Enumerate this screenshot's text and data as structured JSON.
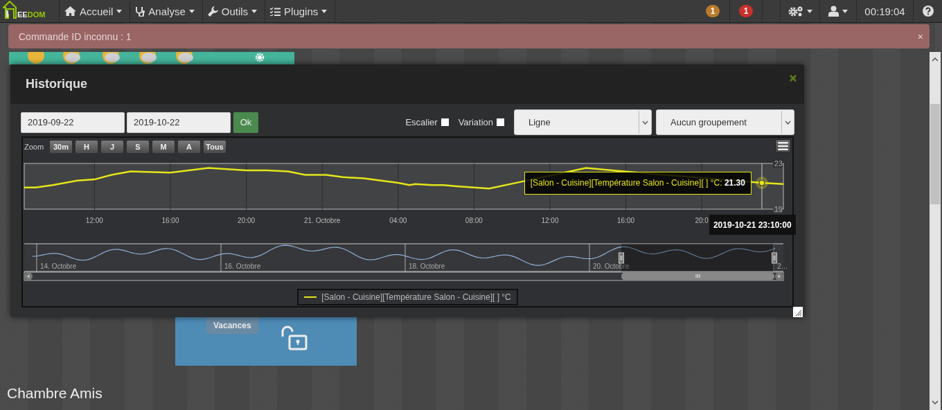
{
  "navbar": {
    "logo": {
      "parts": [
        "EE",
        "DOM"
      ]
    },
    "menus": [
      {
        "label": "Accueil"
      },
      {
        "label": "Analyse"
      },
      {
        "label": "Outils"
      },
      {
        "label": "Plugins"
      }
    ],
    "badges": [
      {
        "count": "1",
        "color": "#b97a2b"
      },
      {
        "count": "1",
        "color": "#c9302c"
      }
    ],
    "clock": "00:19:04"
  },
  "alert": {
    "message": "Commande ID inconnu : 1",
    "close": "×"
  },
  "background": {
    "tile": {
      "badge": "Vacances"
    },
    "room_title": "Chambre Amis"
  },
  "modal": {
    "title": "Historique",
    "start_date": "2019-09-22",
    "end_date": "2019-10-22",
    "ok": "Ok",
    "options": [
      {
        "label": "Escalier",
        "checked": false
      },
      {
        "label": "Variation",
        "checked": false
      }
    ],
    "selects": [
      {
        "value": "Ligne"
      },
      {
        "value": "Aucun groupement"
      }
    ],
    "chart": {
      "zoom_label": "Zoom",
      "zoom_buttons": [
        "30m",
        "H",
        "J",
        "S",
        "M",
        "A",
        "Tous"
      ],
      "chart_data": {
        "type": "line",
        "grid": true,
        "x": [
          "2019-10-20 08:18",
          "2019-10-20 08:54",
          "2019-10-20 09:48",
          "2019-10-20 11:06",
          "2019-10-20 12:00",
          "2019-10-20 12:54",
          "2019-10-20 13:54",
          "2019-10-20 16:00",
          "2019-10-20 18:00",
          "2019-10-20 20:00",
          "2019-10-20 21:06",
          "2019-10-20 22:12",
          "2019-10-20 23:06",
          "2019-10-21 00:12",
          "2019-10-21 01:06",
          "2019-10-21 02:12",
          "2019-10-21 04:00",
          "2019-10-21 04:36",
          "2019-10-21 04:54",
          "2019-10-21 05:48",
          "2019-10-21 06:24",
          "2019-10-21 07:06",
          "2019-10-21 08:00",
          "2019-10-21 08:48",
          "2019-10-21 10:30",
          "2019-10-21 13:54",
          "2019-10-21 15:54",
          "2019-10-21 23:10",
          "2019-10-22 00:18"
        ],
        "series": [
          {
            "name": "[Salon - Cuisine][Température Salon - Cuisine][ ] °C",
            "color": "#e5e51a",
            "values": [
              20.9,
              20.9,
              21.1,
              21.5,
              21.6,
              22.0,
              22.3,
              22.2,
              22.6,
              22.4,
              22.4,
              22.3,
              22.0,
              22.0,
              21.8,
              21.7,
              21.3,
              21.1,
              21.2,
              21.1,
              21.1,
              21.0,
              20.9,
              20.8,
              21.4,
              22.6,
              22.3,
              21.3,
              21.2
            ]
          }
        ],
        "xlim": [
          "2019-10-20 08:18",
          "2019-10-22 00:18"
        ],
        "ylim": [
          19,
          23
        ],
        "xticks": [
          {
            "value": "2019-10-20 12:00",
            "label": "12:00"
          },
          {
            "value": "2019-10-20 16:00",
            "label": "16:00"
          },
          {
            "value": "2019-10-20 20:00",
            "label": "20:00"
          },
          {
            "value": "2019-10-21 00:00",
            "label": "21. Octobre"
          },
          {
            "value": "2019-10-21 04:00",
            "label": "04:00"
          },
          {
            "value": "2019-10-21 08:00",
            "label": "08:00"
          },
          {
            "value": "2019-10-21 12:00",
            "label": "12:00"
          },
          {
            "value": "2019-10-21 16:00",
            "label": "16:00"
          },
          {
            "value": "2019-10-21 20:00",
            "label": "20:0"
          }
        ],
        "yticks": [
          19,
          23
        ],
        "ref_lines": [
          {
            "axis": "x",
            "value": "2019-10-21 23:10"
          }
        ],
        "annotations": [
          {
            "x": "2019-10-21 23:10",
            "y": 21.3,
            "text": "[Salon - Cuisine][Température Salon - Cuisine][ ] °C: **21.30**"
          }
        ]
      },
      "hover_time": "2019-10-21 23:10:00",
      "navigator": {
        "labels": [
          "14. Octobre",
          "16. Octobre",
          "18. Octobre",
          "20. Octobre",
          "2…"
        ]
      }
    }
  }
}
